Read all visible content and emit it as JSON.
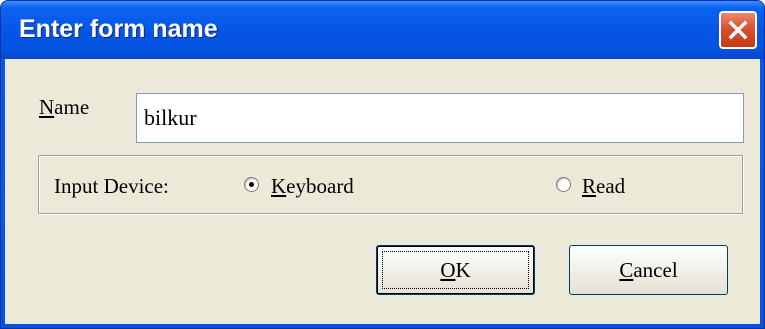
{
  "window": {
    "title": "Enter form name",
    "close_icon": "close-icon"
  },
  "name_field": {
    "label_mnemonic": "N",
    "label_rest": "ame",
    "value": "bilkur"
  },
  "input_device": {
    "label": "Input Device:",
    "options": [
      {
        "mnemonic": "K",
        "rest": "eyboard",
        "selected": true
      },
      {
        "mnemonic": "R",
        "rest": "ead",
        "selected": false
      }
    ]
  },
  "buttons": {
    "ok": {
      "mnemonic": "O",
      "rest": "K"
    },
    "cancel": {
      "mnemonic": "C",
      "rest": "ancel"
    }
  },
  "colors": {
    "titlebar": "#0654e4",
    "client_bg": "#ece9d8",
    "close_button": "#d9512f"
  }
}
